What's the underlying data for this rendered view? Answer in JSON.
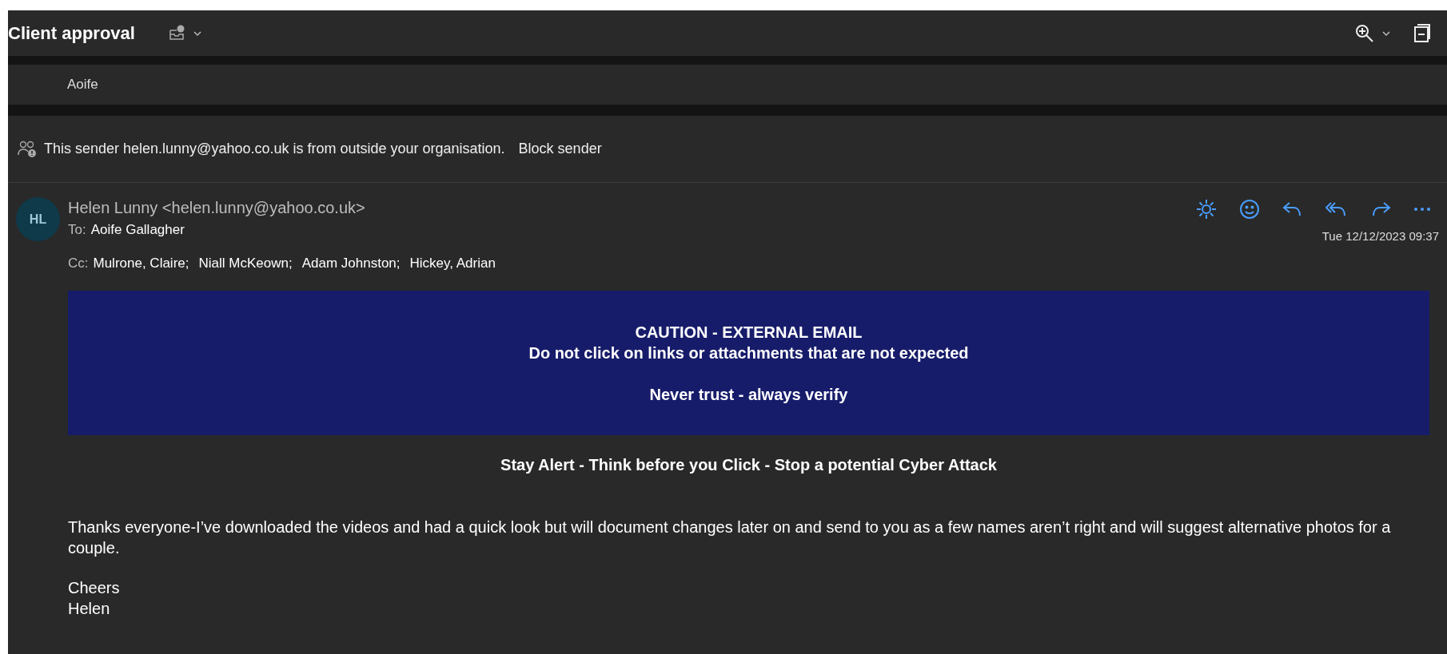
{
  "window": {
    "title": "Client approval"
  },
  "previous_message": {
    "signature": "Aoife"
  },
  "external_notice": {
    "text": "This sender helen.lunny@yahoo.co.uk is from outside your organisation.",
    "action": "Block sender"
  },
  "message": {
    "avatar_initials": "HL",
    "from": "Helen Lunny <helen.lunny@yahoo.co.uk>",
    "to_label": "To:",
    "to": [
      "Aoife Gallagher"
    ],
    "cc_label": "Cc:",
    "cc": [
      "Mulrone, Claire;",
      "Niall McKeown;",
      "Adam Johnston;",
      "Hickey, Adrian"
    ],
    "date": "Tue 12/12/2023 09:37",
    "banner": [
      "CAUTION - EXTERNAL EMAIL",
      "Do not click on links or attachments that are not expected",
      "Never trust - always verify"
    ],
    "alert": "Stay Alert - Think before you Click - Stop a potential Cyber Attack",
    "body": [
      "Thanks everyone-I’ve downloaded the videos and had a quick look but will document changes later on and send to you as a few names aren’t right and will suggest alternative photos for a couple.",
      "Cheers\nHelen"
    ]
  }
}
